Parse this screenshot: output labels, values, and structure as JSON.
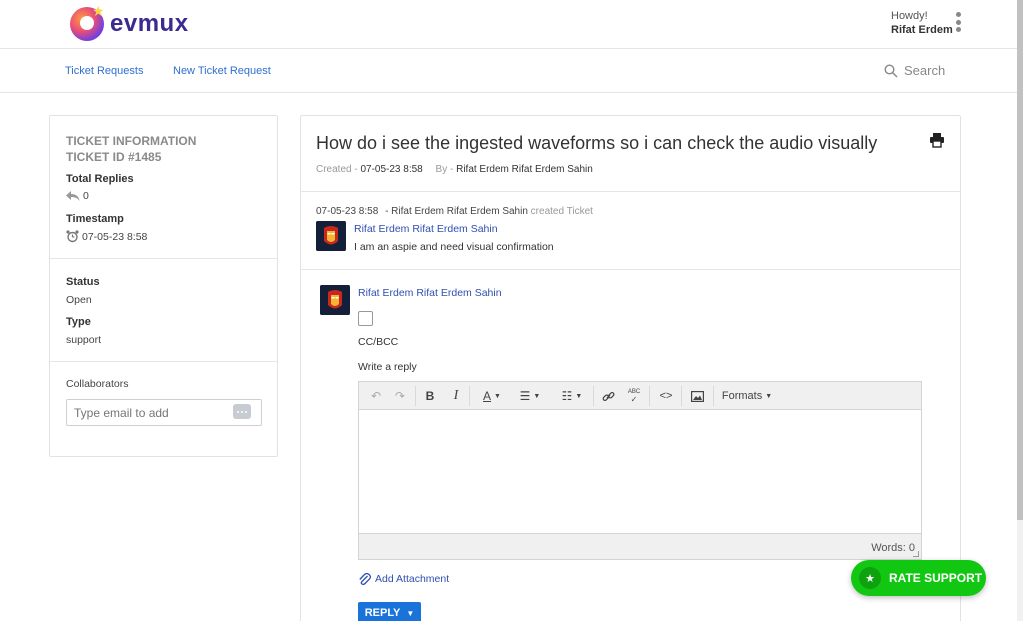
{
  "brand": {
    "name": "evmux"
  },
  "user": {
    "greeting": "Howdy!",
    "name": "Rifat Erdem"
  },
  "nav": {
    "links": [
      {
        "label": "Ticket Requests"
      },
      {
        "label": "New Ticket Request"
      }
    ],
    "search_label": "Search"
  },
  "ticket_info": {
    "heading": "TICKET INFORMATION",
    "ticket_id": "TICKET ID #1485",
    "total_replies_label": "Total Replies",
    "total_replies": "0",
    "timestamp_label": "Timestamp",
    "timestamp": "07-05-23 8:58",
    "status_label": "Status",
    "status": "Open",
    "type_label": "Type",
    "type": "support",
    "collaborators_label": "Collaborators",
    "collaborators_placeholder": "Type email to add"
  },
  "ticket": {
    "title": "How do i see the ingested waveforms so i can check the audio visually",
    "created_label": "Created -",
    "created": "07-05-23 8:58",
    "by_label": "By -",
    "by": "Rifat Erdem Rifat Erdem Sahin"
  },
  "thread": {
    "timestamp": "07-05-23 8:58",
    "actor": "- Rifat Erdem Rifat Erdem Sahin",
    "action": "created Ticket",
    "author": "Rifat Erdem Rifat Erdem Sahin",
    "message": "I am an aspie and need visual confirmation"
  },
  "reply": {
    "author": "Rifat Erdem Rifat Erdem Sahin",
    "cc_label": "CC/BCC",
    "write_label": "Write a reply",
    "formats_label": "Formats",
    "words_label": "Words: 0",
    "attach_label": "Add Attachment",
    "reply_button": "REPLY"
  },
  "rate_support": "RATE SUPPORT",
  "colors": {
    "accent": "#2f6fd1",
    "reply": "#1a73d9",
    "rate": "#12c712"
  }
}
